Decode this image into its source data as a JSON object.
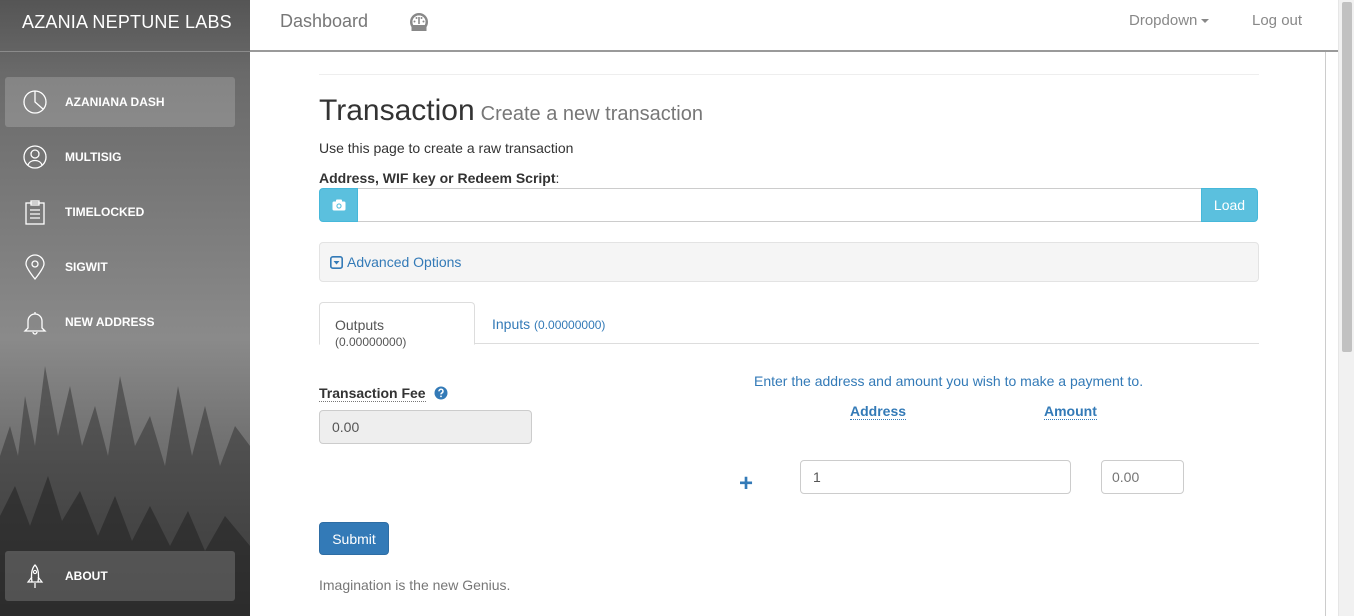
{
  "sidebar": {
    "brand": "AZANIA NEPTUNE LABS",
    "items": [
      {
        "label": "AZANIANA DASH",
        "icon": "pie-chart-icon",
        "active": true
      },
      {
        "label": "MULTISIG",
        "icon": "user-icon",
        "active": false
      },
      {
        "label": "TIMELOCKED",
        "icon": "clipboard-icon",
        "active": false
      },
      {
        "label": "SIGWIT",
        "icon": "map-pin-icon",
        "active": false
      },
      {
        "label": "NEW ADDRESS",
        "icon": "bell-icon",
        "active": false
      }
    ],
    "about": {
      "label": "ABOUT",
      "icon": "rocket-icon"
    }
  },
  "topnav": {
    "title": "Dashboard",
    "title_icon": "dashboard-icon",
    "dropdown": "Dropdown",
    "logout": "Log out"
  },
  "main": {
    "heading": "Transaction",
    "subheading": "Create a new transaction",
    "intro": "Use this page to create a raw transaction",
    "address_label": "Address, WIF key or Redeem Script",
    "address_label_suffix": ":",
    "address_value": "",
    "camera_icon": "camera-icon",
    "load_button": "Load",
    "advanced_options": "Advanced Options",
    "tabs": [
      {
        "label": "Outputs",
        "amount": "(0.00000000)",
        "active": true
      },
      {
        "label": "Inputs",
        "amount": "(0.00000000)",
        "active": false
      }
    ],
    "fee": {
      "label": "Transaction Fee",
      "value": "0.00",
      "help_icon": "question-circle-icon"
    },
    "outputs": {
      "hint": "Enter the address and amount you wish to make a payment to.",
      "address_header": "Address",
      "amount_header": "Amount",
      "add_symbol": "+",
      "address_value": "1",
      "amount_placeholder": "0.00"
    },
    "submit": "Submit",
    "footer": "Imagination is the new Genius."
  },
  "colors": {
    "primary": "#337ab7",
    "info": "#5bc0de",
    "sidebar_text": "#ffffff"
  }
}
